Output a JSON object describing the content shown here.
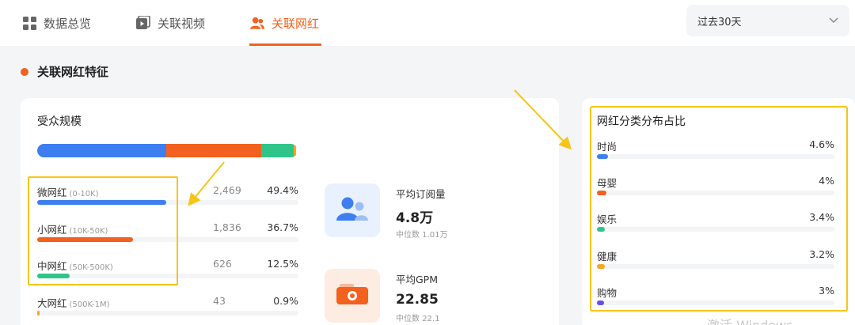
{
  "tabs": [
    {
      "label": "数据总览",
      "icon": "grid-icon"
    },
    {
      "label": "关联视频",
      "icon": "video-icon"
    },
    {
      "label": "关联网红",
      "icon": "users-icon",
      "active": true
    }
  ],
  "date_range": {
    "value": "过去30天"
  },
  "section_title": "关联网红特征",
  "audience": {
    "title": "受众规模",
    "stack_colors": [
      "#3d7ff0",
      "#f2611d",
      "#2fc58a",
      "#f5a623"
    ],
    "rows": [
      {
        "name": "微网红",
        "range": "(0-10K)",
        "count": "2,469",
        "pct": "49.4%",
        "value": 49.4,
        "color": "#3d7ff0"
      },
      {
        "name": "小网红",
        "range": "(10K-50K)",
        "count": "1,836",
        "pct": "36.7%",
        "value": 36.7,
        "color": "#f2611d"
      },
      {
        "name": "中网红",
        "range": "(50K-500K)",
        "count": "626",
        "pct": "12.5%",
        "value": 12.5,
        "color": "#2fc58a"
      },
      {
        "name": "大网红",
        "range": "(500K-1M)",
        "count": "43",
        "pct": "0.9%",
        "value": 0.9,
        "color": "#f5a623"
      }
    ]
  },
  "metrics": [
    {
      "label": "平均订阅量",
      "value": "4.8万",
      "sub": "中位数 1.01万",
      "icon": "users-icon",
      "bg": "#eaf1fe",
      "color": "#3d7ff0"
    },
    {
      "label": "平均GPM",
      "value": "22.85",
      "sub": "中位数 22.1",
      "icon": "wallet-icon",
      "bg": "#fdece2",
      "color": "#f2611d"
    }
  ],
  "categories": {
    "title": "网红分类分布占比",
    "rows": [
      {
        "name": "时尚",
        "pct": "4.6%",
        "value": 4.6,
        "color": "#3d7ff0"
      },
      {
        "name": "母婴",
        "pct": "4%",
        "value": 4.0,
        "color": "#f2611d"
      },
      {
        "name": "娱乐",
        "pct": "3.4%",
        "value": 3.4,
        "color": "#2fc58a"
      },
      {
        "name": "健康",
        "pct": "3.2%",
        "value": 3.2,
        "color": "#f5a623"
      },
      {
        "name": "购物",
        "pct": "3%",
        "value": 3.0,
        "color": "#6a4cf0"
      }
    ]
  },
  "watermark": "激活 Windows"
}
